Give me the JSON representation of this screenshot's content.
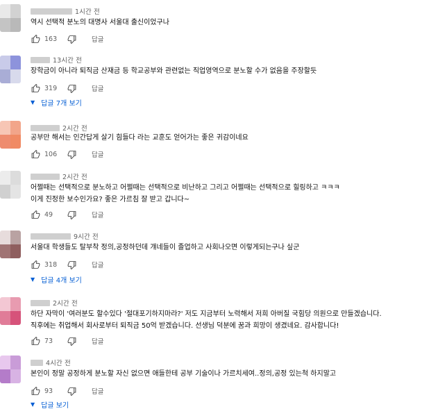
{
  "comments": [
    {
      "time": "1시간 전",
      "text": [
        "역시 선택적 분노의 대명사 서울대 출신이었구나"
      ],
      "likes": "163",
      "reply_label": "답글",
      "replies": ""
    },
    {
      "time": "13시간 전",
      "text": [
        "장학금이 아니라 퇴직금 산재금 등 학교공부와 관련없는 직업영역으로 분노할 수가 없음을 주장할듯"
      ],
      "likes": "319",
      "reply_label": "답글",
      "replies": "답글 7개 보기"
    },
    {
      "time": "2시간 전",
      "text": [
        "공부만 해서는 인간답게 살기 힘들다 라는 교훈도 얻어가는 좋은 귀감이네요"
      ],
      "likes": "106",
      "reply_label": "답글",
      "replies": ""
    },
    {
      "time": "2시간 전",
      "text": [
        "어쩔때는 선택적으로 분노하고 어쩔때는 선택적으로 비난하고 그리고 어쩔때는 선택적으로 힐링하고 ㅋㅋㅋ",
        "이게 진정한 보수인가요? 좋은 가르침 잘 받고 갑니다~"
      ],
      "likes": "49",
      "reply_label": "답글",
      "replies": ""
    },
    {
      "time": "9시간 전",
      "text": [
        "서울대 학생들도 탈부착 정의,공정하던데 걔네들이 졸업하고 사회나오면 이렇게되는구나 싶군"
      ],
      "likes": "318",
      "reply_label": "답글",
      "replies": "답글 4개 보기"
    },
    {
      "time": "2시간 전",
      "text": [
        "하단 자막이 '여러분도 할수있다 '절대포기하지마라?' 저도 지금부터 노력해서 저희 아버질 국힘당 의원으로 만들겠습니다.",
        "직후에는 취업해서 회사로부터 퇴직금 50억 받겠습니다. 선생님 덕분에 꿈과 희망이 생겼네요. 감사합니다!"
      ],
      "likes": "73",
      "reply_label": "답글",
      "replies": ""
    },
    {
      "time": "4시간 전",
      "text": [
        "본인이 정말 공정하게 분노할 자신 없으면 애들한테 공부 기술이나 가르치세여..정의,공정 있는척 하지말고"
      ],
      "likes": "93",
      "reply_label": "답글",
      "replies": "답글 보기"
    }
  ],
  "icons": {
    "like": "thumb-up-icon",
    "dislike": "thumb-down-icon",
    "expand": "caret-down-icon"
  },
  "colors": {
    "link": "#065fd4",
    "secondary": "#606060"
  }
}
